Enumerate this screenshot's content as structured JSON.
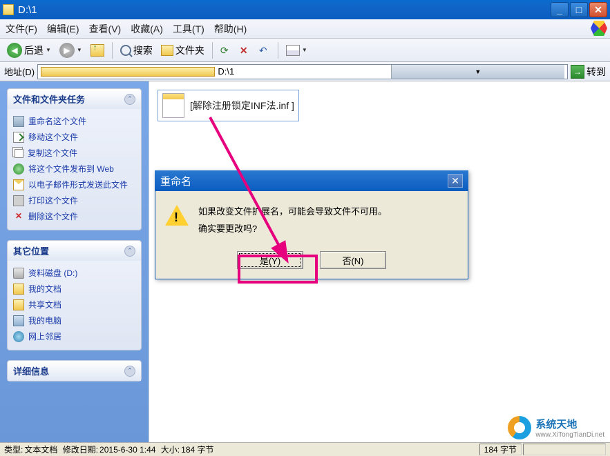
{
  "titlebar": {
    "title": "D:\\1"
  },
  "menubar": {
    "file": "文件(F)",
    "edit": "编辑(E)",
    "view": "查看(V)",
    "favorites": "收藏(A)",
    "tools": "工具(T)",
    "help": "帮助(H)"
  },
  "toolbar": {
    "back": "后退",
    "search": "搜索",
    "folders": "文件夹"
  },
  "addressbar": {
    "label": "地址(D)",
    "path": "D:\\1",
    "go": "转到"
  },
  "tasks_panel": {
    "title": "文件和文件夹任务",
    "items": [
      "重命名这个文件",
      "移动这个文件",
      "复制这个文件",
      "将这个文件发布到 Web",
      "以电子邮件形式发送此文件",
      "打印这个文件",
      "删除这个文件"
    ]
  },
  "other_places": {
    "title": "其它位置",
    "items": [
      "资料磁盘 (D:)",
      "我的文档",
      "共享文档",
      "我的电脑",
      "网上邻居"
    ]
  },
  "details_panel": {
    "title": "详细信息"
  },
  "file": {
    "name": "[解除注册锁定INF法.inf ]"
  },
  "dialog": {
    "title": "重命名",
    "line1": "如果改变文件扩展名，可能会导致文件不可用。",
    "line2": "确实要更改吗?",
    "yes": "是(Y)",
    "no": "否(N)"
  },
  "statusbar": {
    "type_label": "类型:",
    "type_value": "文本文档",
    "date_label": "修改日期:",
    "date_value": "2015-6-30 1:44",
    "size_label": "大小:",
    "size_value": "184 字节",
    "right": "184 字节"
  },
  "watermark": {
    "line1": "系统天地",
    "line2": "www.XiTongTianDi.net"
  }
}
